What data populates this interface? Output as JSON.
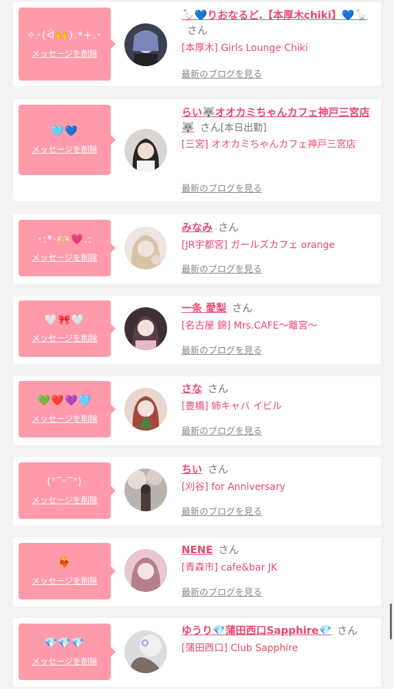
{
  "delete_label": "メッセージを削除",
  "san": "さん",
  "blog_label": "最新のブログを見る",
  "messages": [
    {
      "emoji": "✧･(ᐛ🙌).*+.･",
      "name": "🪿💙りおなるど.【本厚木chiki】💙🪿",
      "extra": "",
      "shop": "[本厚木] Girls Lounge Chiki"
    },
    {
      "emoji": "🩵💙",
      "name": "らい🐺オオカミちゃんカフェ神戸三宮店🐺",
      "extra": "[本日出勤]",
      "shop": "[三宮] オオカミちゃんカフェ神戸三宮店"
    },
    {
      "emoji": "･:*‧🫶🏻💗.:",
      "name": "みなみ",
      "extra": "",
      "shop": "[JR宇都宮] ガールズカフェ orange"
    },
    {
      "emoji": "🤍🎀🤍",
      "name": "一条 愛梨",
      "extra": "",
      "shop": "[名古屋 錦] Mrs.CAFE〜離宮〜"
    },
    {
      "emoji": "💚❤️💜🩵",
      "name": "さな",
      "extra": "",
      "shop": "[豊橋] 姉キャバ イビル"
    },
    {
      "emoji": "(ᐢ‾ᵕ‾ᐢ)",
      "name": "ちい",
      "extra": "",
      "shop": "[刈谷] for Anniversary"
    },
    {
      "emoji": "❤️‍🔥",
      "name": "NENE",
      "extra": "",
      "shop": "[青森市] cafe&bar JK"
    },
    {
      "emoji": "💎💎💎",
      "name": "ゆうり💎蒲田西口Sapphire💎",
      "extra": "",
      "shop": "[蒲田西口] Club Sapphire"
    }
  ],
  "colors": {
    "accent": "#e8496f",
    "bubble": "#ff9aaa",
    "background": "#f3f3f3"
  }
}
